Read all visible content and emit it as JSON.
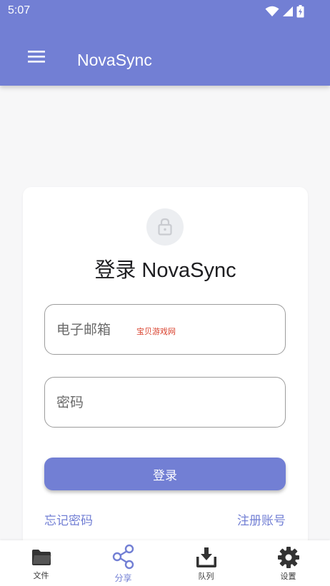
{
  "status_bar": {
    "time": "5:07"
  },
  "app_bar": {
    "title": "NovaSync"
  },
  "login": {
    "title": "登录 NovaSync",
    "email_placeholder": "电子邮箱",
    "password_placeholder": "密码",
    "watermark": "宝贝游戏网",
    "submit_label": "登录",
    "forgot_label": "忘记密码",
    "register_label": "注册账号"
  },
  "bottom_nav": {
    "items": [
      {
        "label": "文件",
        "icon": "folder-icon"
      },
      {
        "label": "分享",
        "icon": "share-icon",
        "active": true
      },
      {
        "label": "队列",
        "icon": "download-queue-icon"
      },
      {
        "label": "设置",
        "icon": "gear-icon"
      }
    ]
  },
  "colors": {
    "primary": "#727fd4",
    "background": "#f7f7f8",
    "card": "#ffffff",
    "icon_dark": "#333333"
  }
}
